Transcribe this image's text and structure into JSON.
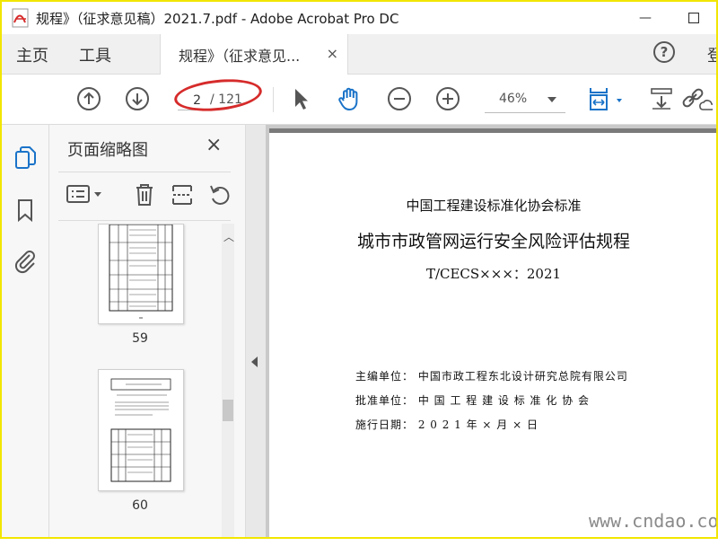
{
  "window": {
    "title": "规程》（征求意见稿）2021.7.pdf - Adobe Acrobat Pro DC",
    "minimize_label": "—",
    "maximize_label": "☐"
  },
  "menu": {
    "home": "主页",
    "tools": "工具",
    "doc_tab_label": "规程》（征求意见...",
    "doc_tab_close": "×",
    "help": "?",
    "signin_partial": "登"
  },
  "toolbar": {
    "page_value": "2",
    "page_total": "/ 121",
    "zoom_value": "46%"
  },
  "panel": {
    "title": "页面缩略图",
    "close": "×",
    "thumbnails": [
      {
        "page_number": "59"
      },
      {
        "page_number": "60"
      }
    ]
  },
  "document": {
    "org_line": "中国工程建设标准化协会标准",
    "title": "城市市政管网运行安全风险评估规程",
    "code": "T/CECS×××：2021",
    "meta": [
      "主编单位：  中国市政工程东北设计研究总院有限公司",
      "批准单位：  中  国  工  程  建  设  标  准  化  协  会",
      "施行日期：  2   0   2   1    年    ×    月    ×    日"
    ]
  },
  "watermark": "www.cndao.com",
  "colors": {
    "accent_blue": "#1a73c8",
    "annotation_red": "#d62b2b",
    "frame_yellow": "#f2e600"
  }
}
